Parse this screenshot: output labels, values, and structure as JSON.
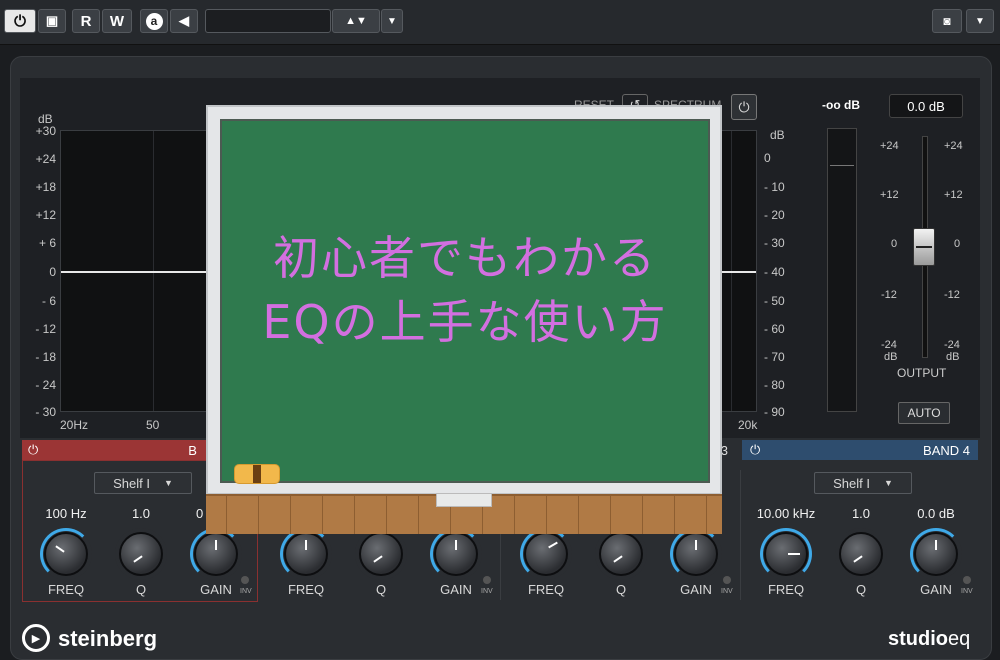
{
  "toolbar": {
    "record_label": "R",
    "write_label": "W",
    "a_label": "a"
  },
  "graph": {
    "db_label_left": "dB",
    "db_label_right": "dB",
    "left_ticks": [
      "+30",
      "+24",
      "+18",
      "+12",
      "+ 6",
      "0",
      "- 6",
      "- 12",
      "- 18",
      "- 24",
      "- 30"
    ],
    "right_ticks": [
      "0",
      "- 10",
      "- 20",
      "- 30",
      "- 40",
      "- 50",
      "- 60",
      "- 70",
      "- 80",
      "- 90"
    ],
    "hz_start": "20Hz",
    "hz_50": "50",
    "hz_end": "20k",
    "reset_label": "RESET",
    "spectrum_label": "SPECTRUM"
  },
  "output": {
    "meter_value": "-oo dB",
    "gain_value": "0.0 dB",
    "scale_left": [
      "+24",
      "+12",
      "0",
      "-12",
      "-24"
    ],
    "scale_right": [
      "+24",
      "+12",
      "0",
      "-12",
      "-24"
    ],
    "db_left": "dB",
    "db_right": "dB",
    "label": "OUTPUT",
    "auto_label": "AUTO"
  },
  "bands": [
    {
      "header": "B",
      "shelf": "Shelf I",
      "freq": "100 Hz",
      "q": "1.0",
      "gain": "0"
    },
    {
      "header": "",
      "shelf": "",
      "freq": "",
      "q": "",
      "gain": ""
    },
    {
      "header": "3",
      "shelf": "",
      "freq": "",
      "q": "",
      "gain": ""
    },
    {
      "header": "BAND 4",
      "shelf": "Shelf I",
      "freq": "10.00 kHz",
      "q": "1.0",
      "gain": "0.0 dB"
    }
  ],
  "knob_labels": {
    "freq": "FREQ",
    "q": "Q",
    "gain": "GAIN",
    "inv": "INV"
  },
  "overlay": {
    "line1": "初心者でもわかる",
    "line2": "EQの上手な使い方"
  },
  "footer": {
    "brand": "steinberg",
    "product_a": "studio",
    "product_b": "eq"
  },
  "colors": {
    "band1": "#9b3535",
    "band4": "#2e4d6e",
    "knob_ring": "#3fa9e8",
    "board": "#2f7a4e",
    "chalk": "#d36fe0"
  }
}
